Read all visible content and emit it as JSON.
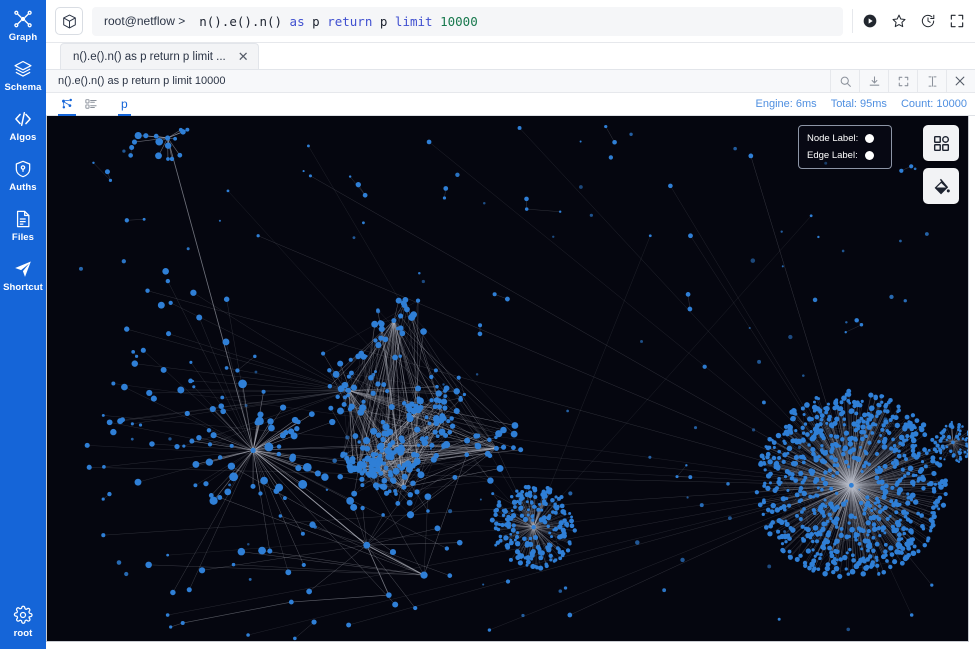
{
  "sidebar": {
    "items": [
      {
        "label": "Graph",
        "icon": "graph-nodes-icon"
      },
      {
        "label": "Schema",
        "icon": "layers-icon"
      },
      {
        "label": "Algos",
        "icon": "code-brackets-icon"
      },
      {
        "label": "Auths",
        "icon": "shield-location-icon"
      },
      {
        "label": "Files",
        "icon": "file-document-icon"
      },
      {
        "label": "Shortcut",
        "icon": "paper-plane-icon"
      }
    ],
    "user": {
      "label": "root",
      "icon": "gear-icon"
    },
    "accent_color": "#1565d8"
  },
  "topbar": {
    "logo_icon": "cube-logo-icon",
    "prompt": "root@netflow >",
    "query_tokens": [
      {
        "text": "n().e().n() ",
        "type": "plain"
      },
      {
        "text": "as",
        "type": "keyword"
      },
      {
        "text": " p ",
        "type": "plain"
      },
      {
        "text": "return",
        "type": "keyword"
      },
      {
        "text": " p ",
        "type": "plain"
      },
      {
        "text": "limit",
        "type": "keyword"
      },
      {
        "text": " ",
        "type": "plain"
      },
      {
        "text": "10000",
        "type": "number"
      }
    ],
    "actions": [
      {
        "name": "run-query-button",
        "icon": "play-circle-icon"
      },
      {
        "name": "favorite-button",
        "icon": "star-icon"
      },
      {
        "name": "query-history-button",
        "icon": "clock-history-icon"
      },
      {
        "name": "fullscreen-button",
        "icon": "expand-arrows-icon"
      }
    ]
  },
  "tabs": [
    {
      "label": "n().e().n() as p return p limit ...",
      "active": true,
      "close_icon": "close-icon"
    }
  ],
  "subbar": {
    "query": "n().e().n() as p return p limit 10000",
    "actions": [
      {
        "name": "search-results-button",
        "icon": "search-icon"
      },
      {
        "name": "download-results-button",
        "icon": "download-icon"
      },
      {
        "name": "maximize-panel-button",
        "icon": "expand-corners-icon"
      },
      {
        "name": "split-panel-button",
        "icon": "split-view-icon"
      },
      {
        "name": "close-panel-button",
        "icon": "close-icon"
      }
    ]
  },
  "results": {
    "views": [
      {
        "name": "graph-view-tab",
        "icon": "graph-view-icon",
        "active": true
      },
      {
        "name": "table-view-tab",
        "icon": "table-view-icon",
        "active": false
      }
    ],
    "alias_tab": "p",
    "stats": {
      "engine": "Engine: 6ms",
      "total": "Total: 95ms",
      "count": "Count: 10000"
    },
    "stats_color": "#4f8fe0"
  },
  "graph": {
    "background": "#05060f",
    "node_color": "#2f7fd6",
    "edge_color": "#b9bcc6",
    "label_panel": {
      "node_label": "Node Label:",
      "edge_label": "Edge Label:"
    },
    "tools": [
      {
        "name": "legend-shapes-button",
        "icon": "legend-grid-icon"
      },
      {
        "name": "paint-style-button",
        "icon": "paint-bucket-icon"
      }
    ]
  }
}
